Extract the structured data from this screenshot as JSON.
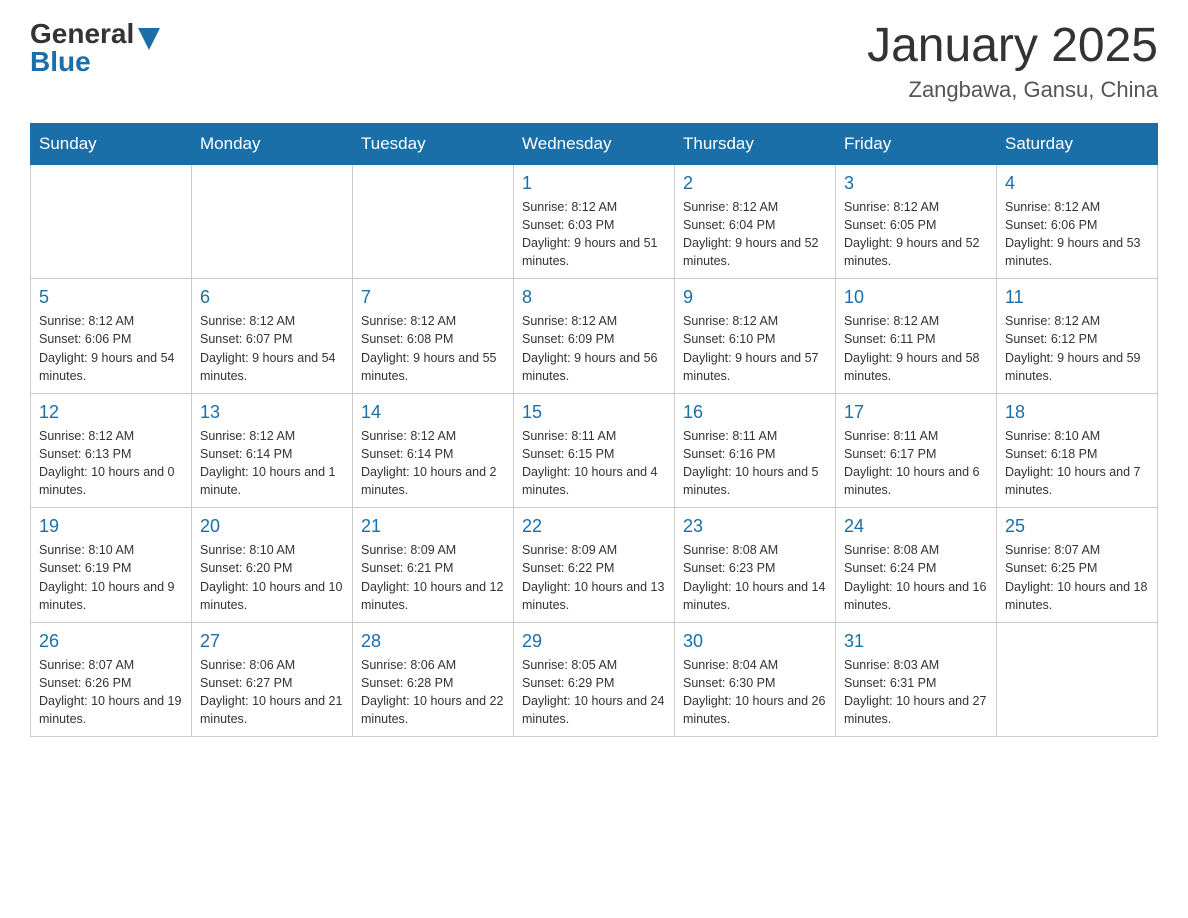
{
  "logo": {
    "general": "General",
    "blue": "Blue"
  },
  "title": {
    "month_year": "January 2025",
    "location": "Zangbawa, Gansu, China"
  },
  "headers": [
    "Sunday",
    "Monday",
    "Tuesday",
    "Wednesday",
    "Thursday",
    "Friday",
    "Saturday"
  ],
  "weeks": [
    [
      {
        "day": "",
        "sunrise": "",
        "sunset": "",
        "daylight": ""
      },
      {
        "day": "",
        "sunrise": "",
        "sunset": "",
        "daylight": ""
      },
      {
        "day": "",
        "sunrise": "",
        "sunset": "",
        "daylight": ""
      },
      {
        "day": "1",
        "sunrise": "Sunrise: 8:12 AM",
        "sunset": "Sunset: 6:03 PM",
        "daylight": "Daylight: 9 hours and 51 minutes."
      },
      {
        "day": "2",
        "sunrise": "Sunrise: 8:12 AM",
        "sunset": "Sunset: 6:04 PM",
        "daylight": "Daylight: 9 hours and 52 minutes."
      },
      {
        "day": "3",
        "sunrise": "Sunrise: 8:12 AM",
        "sunset": "Sunset: 6:05 PM",
        "daylight": "Daylight: 9 hours and 52 minutes."
      },
      {
        "day": "4",
        "sunrise": "Sunrise: 8:12 AM",
        "sunset": "Sunset: 6:06 PM",
        "daylight": "Daylight: 9 hours and 53 minutes."
      }
    ],
    [
      {
        "day": "5",
        "sunrise": "Sunrise: 8:12 AM",
        "sunset": "Sunset: 6:06 PM",
        "daylight": "Daylight: 9 hours and 54 minutes."
      },
      {
        "day": "6",
        "sunrise": "Sunrise: 8:12 AM",
        "sunset": "Sunset: 6:07 PM",
        "daylight": "Daylight: 9 hours and 54 minutes."
      },
      {
        "day": "7",
        "sunrise": "Sunrise: 8:12 AM",
        "sunset": "Sunset: 6:08 PM",
        "daylight": "Daylight: 9 hours and 55 minutes."
      },
      {
        "day": "8",
        "sunrise": "Sunrise: 8:12 AM",
        "sunset": "Sunset: 6:09 PM",
        "daylight": "Daylight: 9 hours and 56 minutes."
      },
      {
        "day": "9",
        "sunrise": "Sunrise: 8:12 AM",
        "sunset": "Sunset: 6:10 PM",
        "daylight": "Daylight: 9 hours and 57 minutes."
      },
      {
        "day": "10",
        "sunrise": "Sunrise: 8:12 AM",
        "sunset": "Sunset: 6:11 PM",
        "daylight": "Daylight: 9 hours and 58 minutes."
      },
      {
        "day": "11",
        "sunrise": "Sunrise: 8:12 AM",
        "sunset": "Sunset: 6:12 PM",
        "daylight": "Daylight: 9 hours and 59 minutes."
      }
    ],
    [
      {
        "day": "12",
        "sunrise": "Sunrise: 8:12 AM",
        "sunset": "Sunset: 6:13 PM",
        "daylight": "Daylight: 10 hours and 0 minutes."
      },
      {
        "day": "13",
        "sunrise": "Sunrise: 8:12 AM",
        "sunset": "Sunset: 6:14 PM",
        "daylight": "Daylight: 10 hours and 1 minute."
      },
      {
        "day": "14",
        "sunrise": "Sunrise: 8:12 AM",
        "sunset": "Sunset: 6:14 PM",
        "daylight": "Daylight: 10 hours and 2 minutes."
      },
      {
        "day": "15",
        "sunrise": "Sunrise: 8:11 AM",
        "sunset": "Sunset: 6:15 PM",
        "daylight": "Daylight: 10 hours and 4 minutes."
      },
      {
        "day": "16",
        "sunrise": "Sunrise: 8:11 AM",
        "sunset": "Sunset: 6:16 PM",
        "daylight": "Daylight: 10 hours and 5 minutes."
      },
      {
        "day": "17",
        "sunrise": "Sunrise: 8:11 AM",
        "sunset": "Sunset: 6:17 PM",
        "daylight": "Daylight: 10 hours and 6 minutes."
      },
      {
        "day": "18",
        "sunrise": "Sunrise: 8:10 AM",
        "sunset": "Sunset: 6:18 PM",
        "daylight": "Daylight: 10 hours and 7 minutes."
      }
    ],
    [
      {
        "day": "19",
        "sunrise": "Sunrise: 8:10 AM",
        "sunset": "Sunset: 6:19 PM",
        "daylight": "Daylight: 10 hours and 9 minutes."
      },
      {
        "day": "20",
        "sunrise": "Sunrise: 8:10 AM",
        "sunset": "Sunset: 6:20 PM",
        "daylight": "Daylight: 10 hours and 10 minutes."
      },
      {
        "day": "21",
        "sunrise": "Sunrise: 8:09 AM",
        "sunset": "Sunset: 6:21 PM",
        "daylight": "Daylight: 10 hours and 12 minutes."
      },
      {
        "day": "22",
        "sunrise": "Sunrise: 8:09 AM",
        "sunset": "Sunset: 6:22 PM",
        "daylight": "Daylight: 10 hours and 13 minutes."
      },
      {
        "day": "23",
        "sunrise": "Sunrise: 8:08 AM",
        "sunset": "Sunset: 6:23 PM",
        "daylight": "Daylight: 10 hours and 14 minutes."
      },
      {
        "day": "24",
        "sunrise": "Sunrise: 8:08 AM",
        "sunset": "Sunset: 6:24 PM",
        "daylight": "Daylight: 10 hours and 16 minutes."
      },
      {
        "day": "25",
        "sunrise": "Sunrise: 8:07 AM",
        "sunset": "Sunset: 6:25 PM",
        "daylight": "Daylight: 10 hours and 18 minutes."
      }
    ],
    [
      {
        "day": "26",
        "sunrise": "Sunrise: 8:07 AM",
        "sunset": "Sunset: 6:26 PM",
        "daylight": "Daylight: 10 hours and 19 minutes."
      },
      {
        "day": "27",
        "sunrise": "Sunrise: 8:06 AM",
        "sunset": "Sunset: 6:27 PM",
        "daylight": "Daylight: 10 hours and 21 minutes."
      },
      {
        "day": "28",
        "sunrise": "Sunrise: 8:06 AM",
        "sunset": "Sunset: 6:28 PM",
        "daylight": "Daylight: 10 hours and 22 minutes."
      },
      {
        "day": "29",
        "sunrise": "Sunrise: 8:05 AM",
        "sunset": "Sunset: 6:29 PM",
        "daylight": "Daylight: 10 hours and 24 minutes."
      },
      {
        "day": "30",
        "sunrise": "Sunrise: 8:04 AM",
        "sunset": "Sunset: 6:30 PM",
        "daylight": "Daylight: 10 hours and 26 minutes."
      },
      {
        "day": "31",
        "sunrise": "Sunrise: 8:03 AM",
        "sunset": "Sunset: 6:31 PM",
        "daylight": "Daylight: 10 hours and 27 minutes."
      },
      {
        "day": "",
        "sunrise": "",
        "sunset": "",
        "daylight": ""
      }
    ]
  ]
}
